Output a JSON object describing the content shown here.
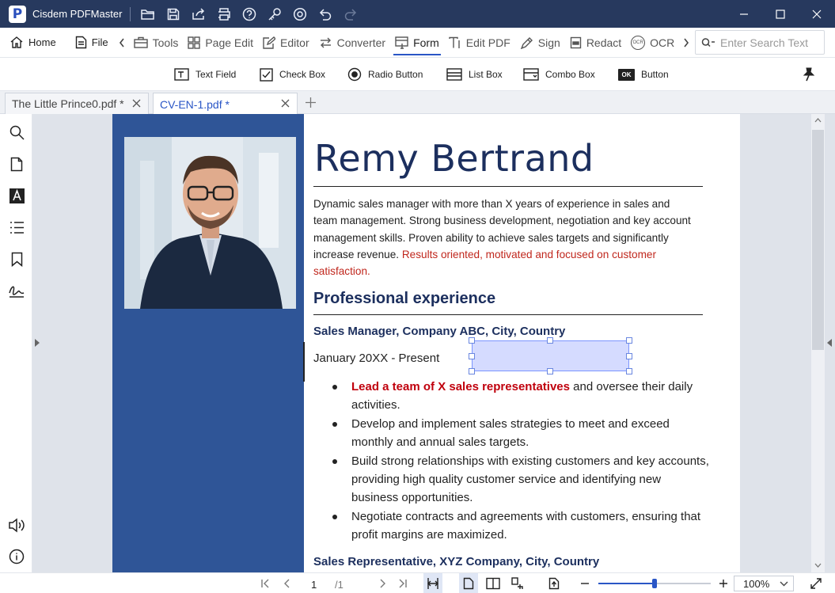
{
  "app": {
    "title": "Cisdem PDFMaster",
    "logo_letter": "P"
  },
  "quick_actions": [
    "open-folder-icon",
    "save-icon",
    "share-icon",
    "print-icon",
    "help-icon",
    "key-icon",
    "settings-icon",
    "undo-icon",
    "redo-icon"
  ],
  "toolbar": {
    "home": "Home",
    "file": "File",
    "tools": "Tools",
    "page_edit": "Page Edit",
    "editor": "Editor",
    "converter": "Converter",
    "form": "Form",
    "edit_pdf": "Edit PDF",
    "sign": "Sign",
    "redact": "Redact",
    "ocr": "OCR",
    "ocr_badge": "OCR",
    "search_placeholder": "Enter Search Text"
  },
  "form_tools": {
    "text_field": "Text Field",
    "check_box": "Check Box",
    "radio_button": "Radio Button",
    "list_box": "List Box",
    "combo_box": "Combo Box",
    "button_badge": "OK",
    "button": "Button"
  },
  "tabs": [
    {
      "label": "The Little Prince0.pdf *",
      "active": false
    },
    {
      "label": "CV-EN-1.pdf *",
      "active": true
    }
  ],
  "sidebar": [
    "search-icon",
    "page-thumbnail-icon",
    "text-icon",
    "list-icon",
    "bookmark-icon",
    "signature-icon",
    "speaker-icon",
    "info-icon"
  ],
  "document": {
    "name": "Remy Bertrand",
    "summary": "Dynamic sales manager with more than X years of experience in sales and team management. Strong business development, negotiation and key account management skills. Proven ability to achieve sales targets and significantly increase revenue.",
    "summary_highlight": "Results oriented, motivated and focused on customer satisfaction.",
    "section_title": "Professional experience",
    "job1_title": "Sales Manager, Company ABC, City, Country",
    "job1_dates": "January 20XX - Present",
    "bullet1_highlight": "Lead a team of X sales representatives",
    "bullet1_rest": "and oversee their daily activities.",
    "bullets": [
      "Develop and implement sales strategies to meet and exceed monthly and annual sales targets.",
      "Build strong relationships with existing customers and key accounts, providing high quality customer service and identifying new business opportunities.",
      "Negotiate contracts and agreements with customers, ensuring that profit margins are maximized."
    ],
    "job2_title": "Sales Representative, XYZ Company, City, Country"
  },
  "status": {
    "current_page": "1",
    "total_pages": "/1",
    "zoom": "100%",
    "zoom_slider_fraction": 0.5
  },
  "colors": {
    "titlebar": "#27395e",
    "accent": "#2a56c6",
    "sidebar_panel": "#2f5597",
    "heading": "#1c2f5e",
    "highlight_red": "#c0271d",
    "form_field": "#d5dbff"
  }
}
